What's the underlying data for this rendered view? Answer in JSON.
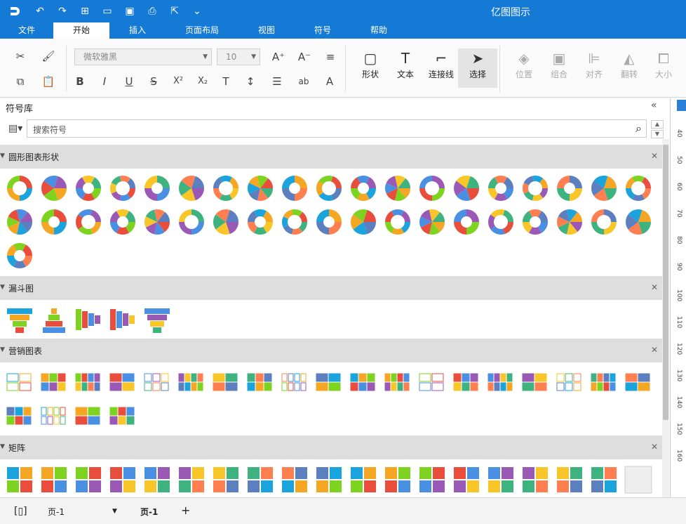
{
  "app": {
    "title": "亿图图示",
    "accent": "#1579d6"
  },
  "quick_access": [
    "logo-icon",
    "undo-icon",
    "redo-icon",
    "new-icon",
    "open-icon",
    "save-icon",
    "print-icon",
    "export-icon",
    "more-icon"
  ],
  "menu": {
    "tabs": [
      "文件",
      "开始",
      "插入",
      "页面布局",
      "视图",
      "符号",
      "帮助"
    ],
    "active": "开始"
  },
  "ribbon": {
    "font_family": "微软雅黑",
    "font_size": "10",
    "shape_label": "形状",
    "text_label": "文本",
    "connector_label": "连接线",
    "select_label": "选择",
    "position_label": "位置",
    "group_label": "组合",
    "align_label": "对齐",
    "flip_label": "翻转",
    "size_label": "大小"
  },
  "library": {
    "title": "符号库",
    "search_placeholder": "搜索符号",
    "categories": [
      {
        "name": "圆形图表形状",
        "count": 39
      },
      {
        "name": "漏斗图",
        "count": 5
      },
      {
        "name": "营销图表",
        "count": 23
      },
      {
        "name": "矩阵",
        "count": 19
      }
    ]
  },
  "ruler": [
    "40",
    "50",
    "60",
    "70",
    "80",
    "90",
    "100",
    "110",
    "120",
    "130",
    "140",
    "150",
    "160"
  ],
  "status": {
    "page_selector": "页-1",
    "page_tab": "页-1",
    "add_page": "+"
  }
}
